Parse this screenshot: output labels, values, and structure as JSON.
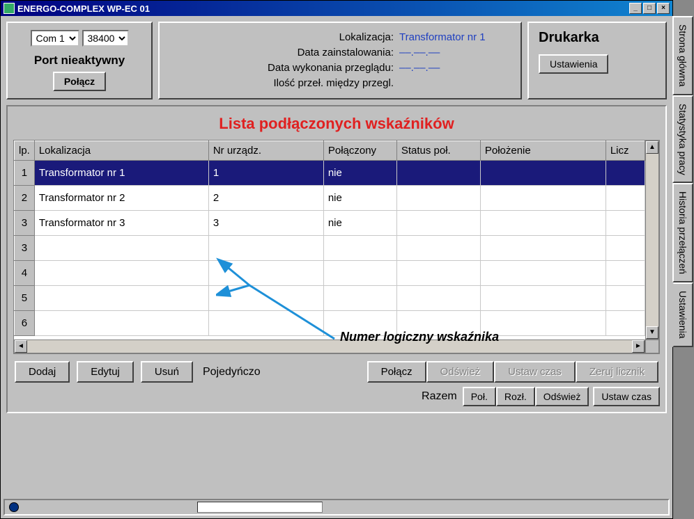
{
  "title": "ENERGO-COMPLEX WP-EC 01",
  "port": {
    "com_options_selected": "Com 1",
    "baud_options_selected": "38400",
    "status": "Port nieaktywny",
    "connect_btn": "Połącz"
  },
  "info": {
    "loc_label": "Lokalizacja:",
    "loc_value": "Transformator nr 1",
    "install_label": "Data zainstalowania:",
    "install_value": "––.––.––",
    "review_label": "Data wykonania przeglądu:",
    "review_value": "––.––.––",
    "count_label": "Ilość przeł. między przegl.",
    "count_value": ""
  },
  "printer": {
    "title": "Drukarka",
    "settings_btn": "Ustawienia"
  },
  "list": {
    "title": "Lista podłączonych wskaźników",
    "cols": {
      "lp": "lp.",
      "loc": "Lokalizacja",
      "dev": "Nr urządz.",
      "conn": "Połączony",
      "status": "Status poł.",
      "pos": "Położenie",
      "licz": "Licz"
    },
    "rows": [
      {
        "lp": "1",
        "loc": "Transformator nr 1",
        "dev": "1",
        "conn": "nie",
        "status": "",
        "pos": ""
      },
      {
        "lp": "2",
        "loc": "Transformator nr 2",
        "dev": "2",
        "conn": "nie",
        "status": "",
        "pos": ""
      },
      {
        "lp": "3",
        "loc": "Transformator nr 3",
        "dev": "3",
        "conn": "nie",
        "status": "",
        "pos": ""
      }
    ],
    "empty_lps": [
      "3",
      "4",
      "5",
      "6"
    ]
  },
  "buttons": {
    "add": "Dodaj",
    "edit": "Edytuj",
    "delete": "Usuń",
    "single": "Pojedyńczo",
    "connect": "Połącz",
    "refresh": "Odśwież",
    "set_time": "Ustaw czas",
    "zero": "Zeruj licznik",
    "together": "Razem",
    "conn_short": "Poł.",
    "disc_short": "Rozł.",
    "refresh2": "Odśwież",
    "set_time2": "Ustaw czas"
  },
  "tabs": {
    "main": "Strona główna",
    "stats": "Statystyka pracy",
    "history": "Historia przełączeń",
    "settings": "Ustawienia"
  },
  "annotation": "Numer logiczny wskaźnika"
}
